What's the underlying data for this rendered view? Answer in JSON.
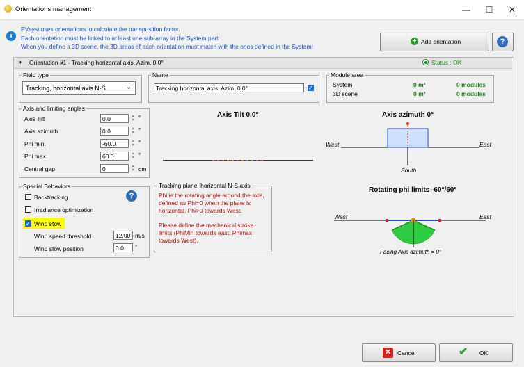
{
  "window": {
    "title": "Orientations management",
    "min": "—",
    "max": "☐",
    "close": "✕"
  },
  "info": {
    "line1": "PVsyst uses orientations to calculate the transposition factor.",
    "line2": "Each orientation must be linked to at least one sub-array in the System part.",
    "line3": "When you define a 3D scene, the 3D areas of each orientation must match with the ones defined in the System!"
  },
  "toolbar": {
    "add_label": "Add orientation",
    "help": "?"
  },
  "orientation": {
    "header": "Orientation #1 - Tracking horizontal axis, Azim. 0.0°",
    "status": "Status : OK"
  },
  "field_type": {
    "legend": "Field type",
    "value": "Tracking, horizontal axis N-S"
  },
  "name": {
    "legend": "Name",
    "value": "Tracking horizontal axis, Azim. 0.0°"
  },
  "module_area": {
    "legend": "Module area",
    "rows": [
      {
        "label": "System",
        "area": "0 m²",
        "modules": "0 modules"
      },
      {
        "label": "3D scene",
        "area": "0 m²",
        "modules": "0 modules"
      }
    ]
  },
  "angles": {
    "legend": "Axis and limiting angles",
    "rows": [
      {
        "label": "Axis Tilt",
        "value": "0.0",
        "unit": "°"
      },
      {
        "label": "Axis azimuth",
        "value": "0.0",
        "unit": "°"
      },
      {
        "label": "Phi min.",
        "value": "-60.0",
        "unit": "°"
      },
      {
        "label": "Phi max.",
        "value": "60.0",
        "unit": "°"
      },
      {
        "label": "Central gap",
        "value": "0",
        "unit": "cm"
      }
    ]
  },
  "special": {
    "legend": "Special Behaviors",
    "backtracking": "Backtracking",
    "irradiance": "Irradiance optimization",
    "wind_stow": "Wind stow",
    "threshold_label": "Wind speed threshold",
    "threshold_value": "12.00",
    "threshold_unit": "m/s",
    "position_label": "Wind stow position",
    "position_value": "0.0",
    "position_unit": "°"
  },
  "diagrams": {
    "tilt_title": "Axis Tilt 0.0°",
    "azimuth_title": "Axis azimuth 0°",
    "west": "West",
    "east": "East",
    "south": "South",
    "phi_title": "Rotating phi limits -60°/60°",
    "facing": "Facing Axis azimuth = 0°"
  },
  "tracking_plane": {
    "legend": "Tracking plane, horizontal N-S axis",
    "text1": "Phi is the rotating angle around the axis, defined as Phi=0 when the plane is horizontal, Phi>0 towards West.",
    "text2": "Please define the mechanical stroke limits (PhiMin towards east, Phimax towards West)."
  },
  "footer": {
    "cancel": "Cancel",
    "ok": "OK"
  },
  "colors": {
    "accent": "#1a7ad4",
    "ok_green": "#1a8a1a",
    "warn_red": "#b01010",
    "highlight": "#ffff00"
  }
}
